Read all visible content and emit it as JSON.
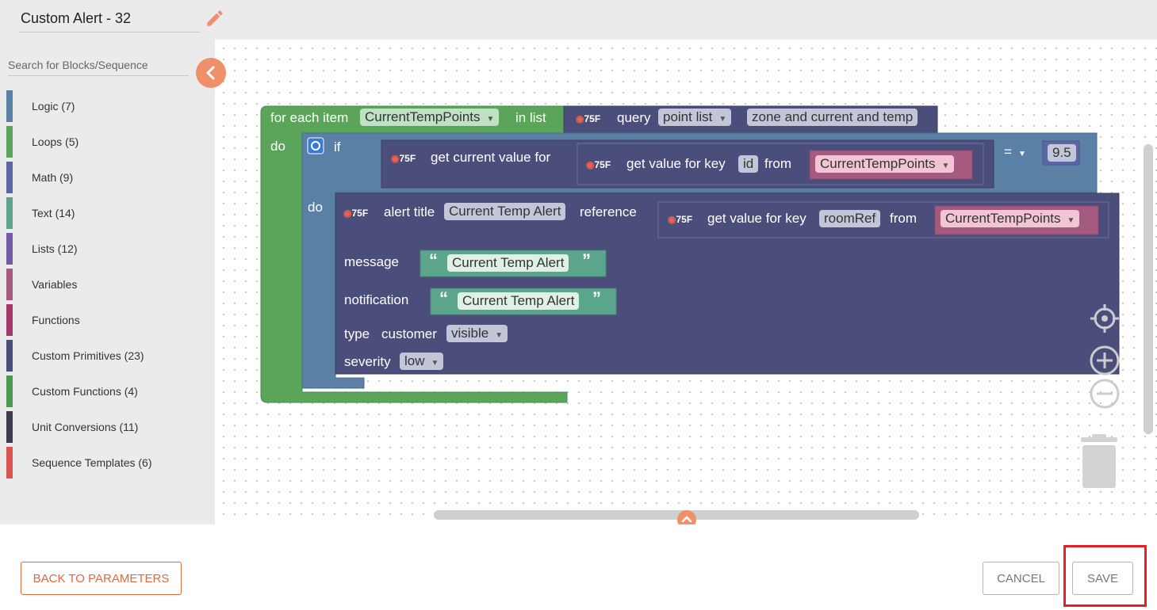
{
  "header": {
    "title": "Custom Alert - 32",
    "edit_icon": "pencil-icon"
  },
  "sidebar": {
    "search_placeholder": "Search for Blocks/Sequence",
    "collapse_icon": "chevron-left-icon",
    "categories": [
      {
        "label": "Logic (7)",
        "color": "#5b80a5"
      },
      {
        "label": "Loops (5)",
        "color": "#5ba55b"
      },
      {
        "label": "Math (9)",
        "color": "#5b67a5"
      },
      {
        "label": "Text (14)",
        "color": "#5ba58c"
      },
      {
        "label": "Lists (12)",
        "color": "#745ba5"
      },
      {
        "label": "Variables",
        "color": "#a55b80"
      },
      {
        "label": "Functions",
        "color": "#a5386b"
      },
      {
        "label": "Custom Primitives (23)",
        "color": "#4b4e7b"
      },
      {
        "label": "Custom Functions (4)",
        "color": "#499a4e"
      },
      {
        "label": "Unit Conversions (11)",
        "color": "#3b3d4e"
      },
      {
        "label": "Sequence Templates (6)",
        "color": "#d9534f"
      }
    ]
  },
  "blocks": {
    "for_each": {
      "label1": "for each item",
      "var": "CurrentTempPoints",
      "label2": "in list",
      "do": "do"
    },
    "query": {
      "icon": "75",
      "icon_unit": "F",
      "label": "query",
      "type": "point list",
      "filter": "zone and current and temp"
    },
    "if_block": {
      "label": "if",
      "do": "do",
      "op": "=",
      "value": "9.5"
    },
    "get_current": {
      "label": "get current value for"
    },
    "get_value_id": {
      "label1": "get value for key",
      "key": "id",
      "label2": "from",
      "var": "CurrentTempPoints"
    },
    "alert": {
      "label1": "alert title",
      "title": "Current Temp Alert",
      "label2": "reference",
      "message_label": "message",
      "message": "Current Temp Alert",
      "notification_label": "notification",
      "notification": "Current Temp Alert",
      "type_label": "type",
      "customer_label": "customer",
      "visibility": "visible",
      "severity_label": "severity",
      "severity": "low"
    },
    "get_value_ref": {
      "label1": "get value for key",
      "key": "roomRef",
      "label2": "from",
      "var": "CurrentTempPoints"
    }
  },
  "workspace": {
    "recenter_icon": "target-icon",
    "zoom_in_icon": "plus-circle-icon",
    "zoom_out_icon": "minus-circle-icon",
    "trash_icon": "trash-icon",
    "expand_icon": "chevron-up-icon"
  },
  "footer": {
    "back_label": "BACK TO PARAMETERS",
    "cancel_label": "CANCEL",
    "save_label": "SAVE"
  }
}
